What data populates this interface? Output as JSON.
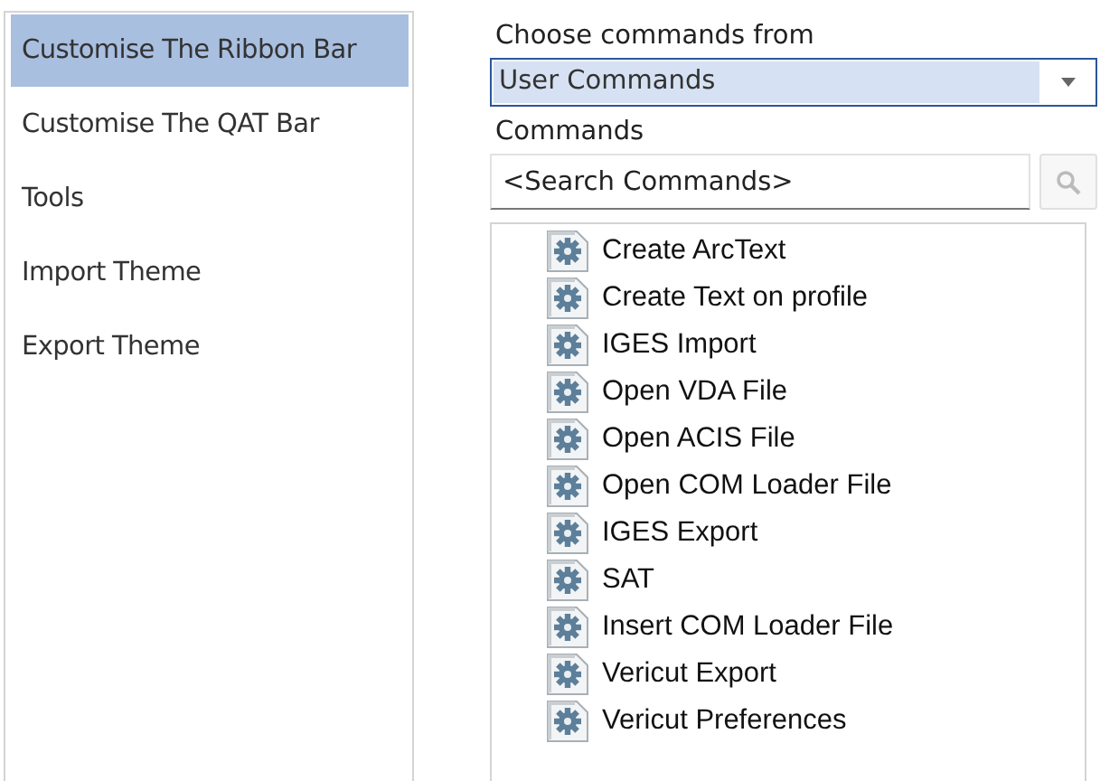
{
  "sidebar": {
    "items": [
      {
        "label": "Customise The Ribbon Bar",
        "selected": true
      },
      {
        "label": "Customise The QAT Bar",
        "selected": false
      },
      {
        "label": "Tools",
        "selected": false
      },
      {
        "label": "Import Theme",
        "selected": false
      },
      {
        "label": "Export Theme",
        "selected": false
      }
    ]
  },
  "choose_label": "Choose commands from",
  "dropdown": {
    "value": "User Commands"
  },
  "commands_label": "Commands",
  "search": {
    "placeholder": "<Search Commands>"
  },
  "commands": [
    "Create ArcText",
    "Create Text on profile",
    "IGES Import",
    "Open VDA File",
    "Open ACIS File",
    "Open COM Loader File",
    "IGES Export",
    "SAT",
    "Insert COM Loader File",
    "Vericut Export",
    "Vericut Preferences"
  ]
}
